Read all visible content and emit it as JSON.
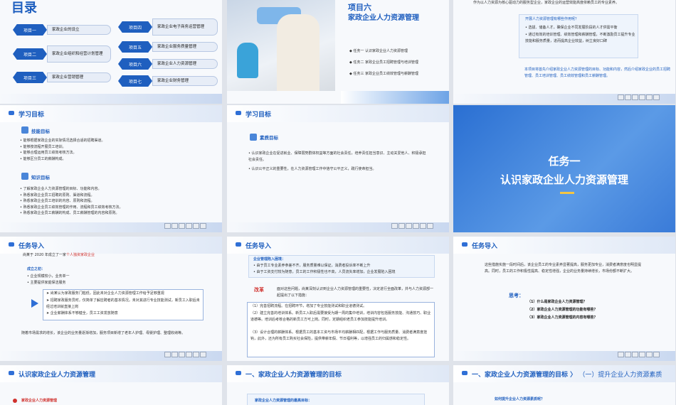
{
  "s1": {
    "title": "目录",
    "items": [
      {
        "badge": "项目一",
        "label": "家政企业的设立"
      },
      {
        "badge": "项目二",
        "label": "家政企业组织和经营计划管理"
      },
      {
        "badge": "项目三",
        "label": "家政企业营销管理"
      },
      {
        "badge": "项目四",
        "label": "家政企业电子商务运营管理"
      },
      {
        "badge": "项目五",
        "label": "家政企业服务质量管理"
      },
      {
        "badge": "项目六",
        "label": "家政企业人力资源管理"
      },
      {
        "badge": "项目七",
        "label": "家政企业财务管理"
      }
    ]
  },
  "s2": {
    "title": "项目六",
    "subtitle": "家政企业人力资源管理",
    "tasks": [
      "任务一  认识家政企业人力资源管理",
      "任务二  家政企业员工招聘管理与培训管理",
      "任务三  家政企业员工绩效管理与薪酬管理"
    ]
  },
  "s3": {
    "lead": "作为以人力资源为核心驱动力的服务型企业，家政企业的运营效能高度依赖员工的专业素养。",
    "q": "开展人力资源管理有哪些作用呢？",
    "bul": [
      "选拔、储备人才，确保企业不同发展阶段的人才供需平衡",
      "通过有效的培训管理、绩效管理和薪酬管理，不断激励员工提升专业技能和服务质量，进而提高企业效益，树立良好口碑"
    ],
    "tail": "本项目将首先介绍家政企业人力资源管理的目标、功能和内容，然后介绍家政企业的员工招聘管理、员工培训管理、员工绩效管理和员工薪酬管理。"
  },
  "s4": {
    "title": "学习目标",
    "h1": "技能目标",
    "b1": [
      "能够根据家政企业的实际情况选择合适的招聘渠道。",
      "能够按流程开展员工培训。",
      "能够合理运用员工绩效考核方法。",
      "能够区分员工的薪酬构成。"
    ],
    "h2": "知识目标",
    "b2": [
      "了解家政企业人力资源管理的目标、功能和内容。",
      "熟悉家政企业员工招聘的原则、渠道和流程。",
      "熟悉家政企业员工培训的内容、原则和流程。",
      "熟悉家政企业员工绩效管理的作用、流程和员工绩效考核方法。",
      "熟悉家政企业员工薪酬的构成、员工薪酬管理的内容和原则。"
    ]
  },
  "s5": {
    "title": "学习目标",
    "h1": "素质目标",
    "b1": [
      "认识家政企业在促进就业、保障弱势群体权益等方面的社会责任，培养责任担当意识、主动关爱他人、积极承担社会责任。",
      "认识公平正义的重要性，在人力资源管理工作中恪守公平正义，践行使命担当。"
    ]
  },
  "s6": {
    "l1": "任务一",
    "l2": "认识家政企业人力资源管理"
  },
  "s7": {
    "title": "任务导入",
    "p1a": "尚某于",
    "p1b": "2020 年成立了一家",
    "p1c": "个人独资家政企业",
    "h": "成立之初：",
    "b": [
      "企业规模较小，业务单一",
      "主要提供家庭保洁服务"
    ],
    "box": [
      "尚某认为家政服务门槛低，因此未对企业人力资源管理工作给予足够重视",
      "招聘家政服务员时，仅简单了解应聘者的基本情况，未对其进行专业技能测试，新员工入职后未经过培训就直接上岗",
      "企业薪酬体系不够健全，员工工资发放随意"
    ],
    "tail": "随着市场需求的增长，该企业的业务量逐渐增加，服务项目新增了老年人护理、母婴护理、整理收纳等。"
  },
  "s8": {
    "title": "任务导入",
    "h": "企业管理陷入困境：",
    "b": [
      "由于员工专业素养参差不齐，服务质量难以保证，消费者投诉率不断上升",
      "由于工资支付较为随意，员工的工作积极性也不高，人员流失率增加，企业发展陷入困境"
    ],
    "gaijin": "改革",
    "gtxt": "面对这些问题，尚某深刻认识到企业人力资源管理的重要性，决定进行全面改革，并与人力资源部一起提出了以下措施：",
    "m": [
      "（1）完善招聘流程。在招聘环节，增加了专业技能测试和职业道德测试。",
      "（2）建立完善的培训体系。新员工入职后需要接受为期一周的集中培训，培训内容包括服务技能、沟通技巧、职业道德等。培训后考核合格的新员工方可上岗。同时，定期组织老员工参加技能提升培训。",
      "（3）设计合理的薪酬体系。根据员工的基本工资与市场平均薪酬相匹配，根据工作与服务质量、消费者满意度挂钩，此外，还为所有员工购买社会保险，提供带薪年假、节日福利等，以增强员工的归属感和稳定性。"
    ]
  },
  "s9": {
    "title": "任务导入",
    "p": "这些措施实施一段时间后，该企业员工的专业素养显著提高，服务更加专业，消费者满意度也明显提高。同时，员工的工作积极性提高、稳定性增强，企业的业务量持续增长，市场份额不断扩大。",
    "think": "思考：",
    "q": [
      "（1）什么是家政企业人力资源管理？",
      "（2）家政企业人力资源管理的功能有哪些？",
      "（3）家政企业人力资源管理的内容有哪些？"
    ]
  },
  "s10": {
    "title": "认识家政企业人力资源管理",
    "t": "家政企业人力资源管理"
  },
  "s11": {
    "title": "一、家政企业人力资源管理的目标",
    "t": "家政企业人力资源管理的最高目标："
  },
  "s12": {
    "title": "一、家政企业人力资源管理的目标",
    "sep": "〉",
    "sub": "（一）提升企业人力资源素质",
    "q": "如何提升企业人力资源素质呢？"
  }
}
